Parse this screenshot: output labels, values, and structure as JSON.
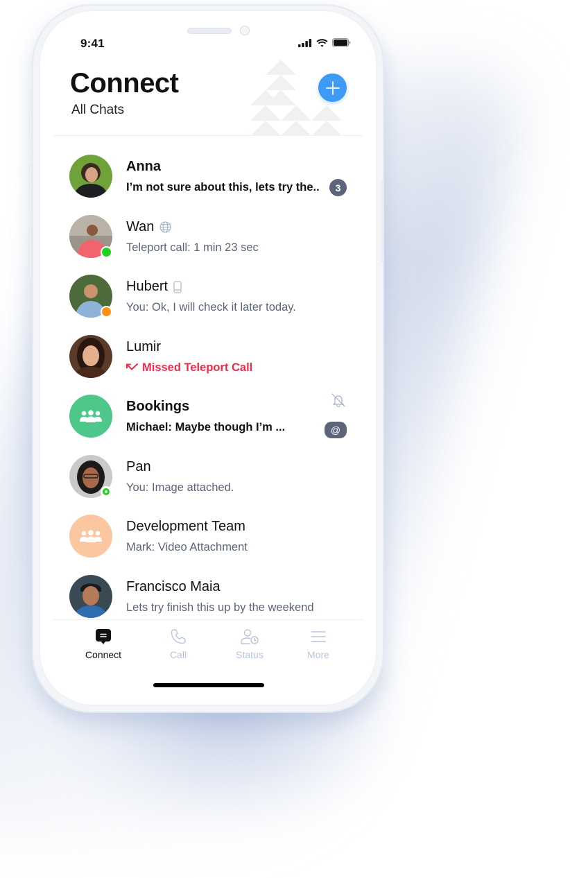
{
  "status_bar": {
    "time": "9:41"
  },
  "header": {
    "title": "Connect",
    "subtitle": "All Chats",
    "add_button_icon": "plus-icon"
  },
  "colors": {
    "accent": "#3d9bf6",
    "badge": "#5c6579",
    "missed": "#ef2b4b",
    "online": "#1fd21f",
    "away": "#ff9214",
    "group_green": "#4ec88a",
    "group_peach": "#fbc7a1",
    "secondary_text": "#5b6478",
    "tab_inactive": "#b9c4da"
  },
  "chats": [
    {
      "name": "Anna",
      "message": "I’m not sure about this, lets try the..",
      "unread": "3",
      "bold": true,
      "avatar": "photo",
      "presence": null
    },
    {
      "name": "Wan",
      "name_icon": "globe-icon",
      "message": "Teleport call: 1 min 23 sec",
      "avatar": "photo",
      "presence": "online"
    },
    {
      "name": "Hubert",
      "name_icon": "mobile-phone-icon",
      "message": "You: Ok, I will check it later today.",
      "avatar": "photo",
      "presence": "away"
    },
    {
      "name": "Lumir",
      "message": "Missed Teleport Call",
      "message_icon": "missed-call-icon",
      "missed": true,
      "avatar": "photo",
      "presence": null
    },
    {
      "name": "Bookings",
      "message": "Michael: Maybe though I’m ...",
      "bold": true,
      "muted": true,
      "mention": "@",
      "avatar": "group-icon"
    },
    {
      "name": "Pan",
      "message": "You: Image attached.",
      "avatar": "photo",
      "presence": "online-ring"
    },
    {
      "name": "Development Team",
      "message": "Mark: Video Attachment",
      "avatar": "group-icon"
    },
    {
      "name": "Francisco Maia",
      "message": "Lets try finish this up by the weekend",
      "avatar": "photo"
    }
  ],
  "tabs": [
    {
      "label": "Connect",
      "icon": "chat-bubble-icon",
      "active": true
    },
    {
      "label": "Call",
      "icon": "phone-icon",
      "active": false
    },
    {
      "label": "Status",
      "icon": "user-clock-icon",
      "active": false
    },
    {
      "label": "More",
      "icon": "menu-icon",
      "active": false
    }
  ]
}
